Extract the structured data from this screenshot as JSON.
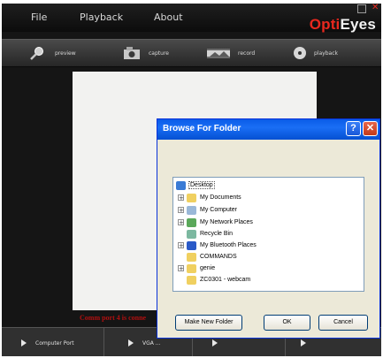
{
  "menu": {
    "file": "File",
    "playback": "Playback",
    "about": "About"
  },
  "logo": {
    "part1": "Opti",
    "part2": "Eyes"
  },
  "window_controls": {
    "minimize_icon": "minimize-icon",
    "close_icon": "close-icon"
  },
  "toolbar": [
    {
      "label": "preview",
      "icon": "magnifier-icon"
    },
    {
      "label": "capture",
      "icon": "camera-icon"
    },
    {
      "label": "record",
      "icon": "film-icon"
    },
    {
      "label": "playback",
      "icon": "disc-icon"
    }
  ],
  "status": {
    "text": "Comm port 4 is conne"
  },
  "bottombar": [
    {
      "label": "Computer Port"
    },
    {
      "label": "VGA ..."
    },
    {
      "label": ""
    },
    {
      "label": ""
    }
  ],
  "dialog": {
    "title": "Browse For Folder",
    "help_label": "?",
    "close_label": "✕",
    "tree": [
      {
        "label": "Desktop",
        "icon": "desktop-icon",
        "level": 0,
        "expander": "",
        "selected": true
      },
      {
        "label": "My Documents",
        "icon": "folder-icon",
        "level": 1,
        "expander": "+"
      },
      {
        "label": "My Computer",
        "icon": "computer-icon",
        "level": 1,
        "expander": "+"
      },
      {
        "label": "My Network Places",
        "icon": "network-icon",
        "level": 1,
        "expander": "+"
      },
      {
        "label": "Recycle Bin",
        "icon": "recycle-bin-icon",
        "level": 1,
        "expander": ""
      },
      {
        "label": "My Bluetooth Places",
        "icon": "bluetooth-icon",
        "level": 1,
        "expander": "+"
      },
      {
        "label": "COMMANDS",
        "icon": "folder-icon",
        "level": 1,
        "expander": ""
      },
      {
        "label": "genie",
        "icon": "folder-icon",
        "level": 1,
        "expander": "+"
      },
      {
        "label": "ZC0301 - webcam",
        "icon": "folder-icon",
        "level": 1,
        "expander": ""
      }
    ],
    "buttons": {
      "make_new_folder": "Make New Folder",
      "ok": "OK",
      "cancel": "Cancel"
    }
  },
  "colors": {
    "accent_red": "#e8281e",
    "xp_blue": "#0a5ce8",
    "status_red": "#b01010"
  }
}
